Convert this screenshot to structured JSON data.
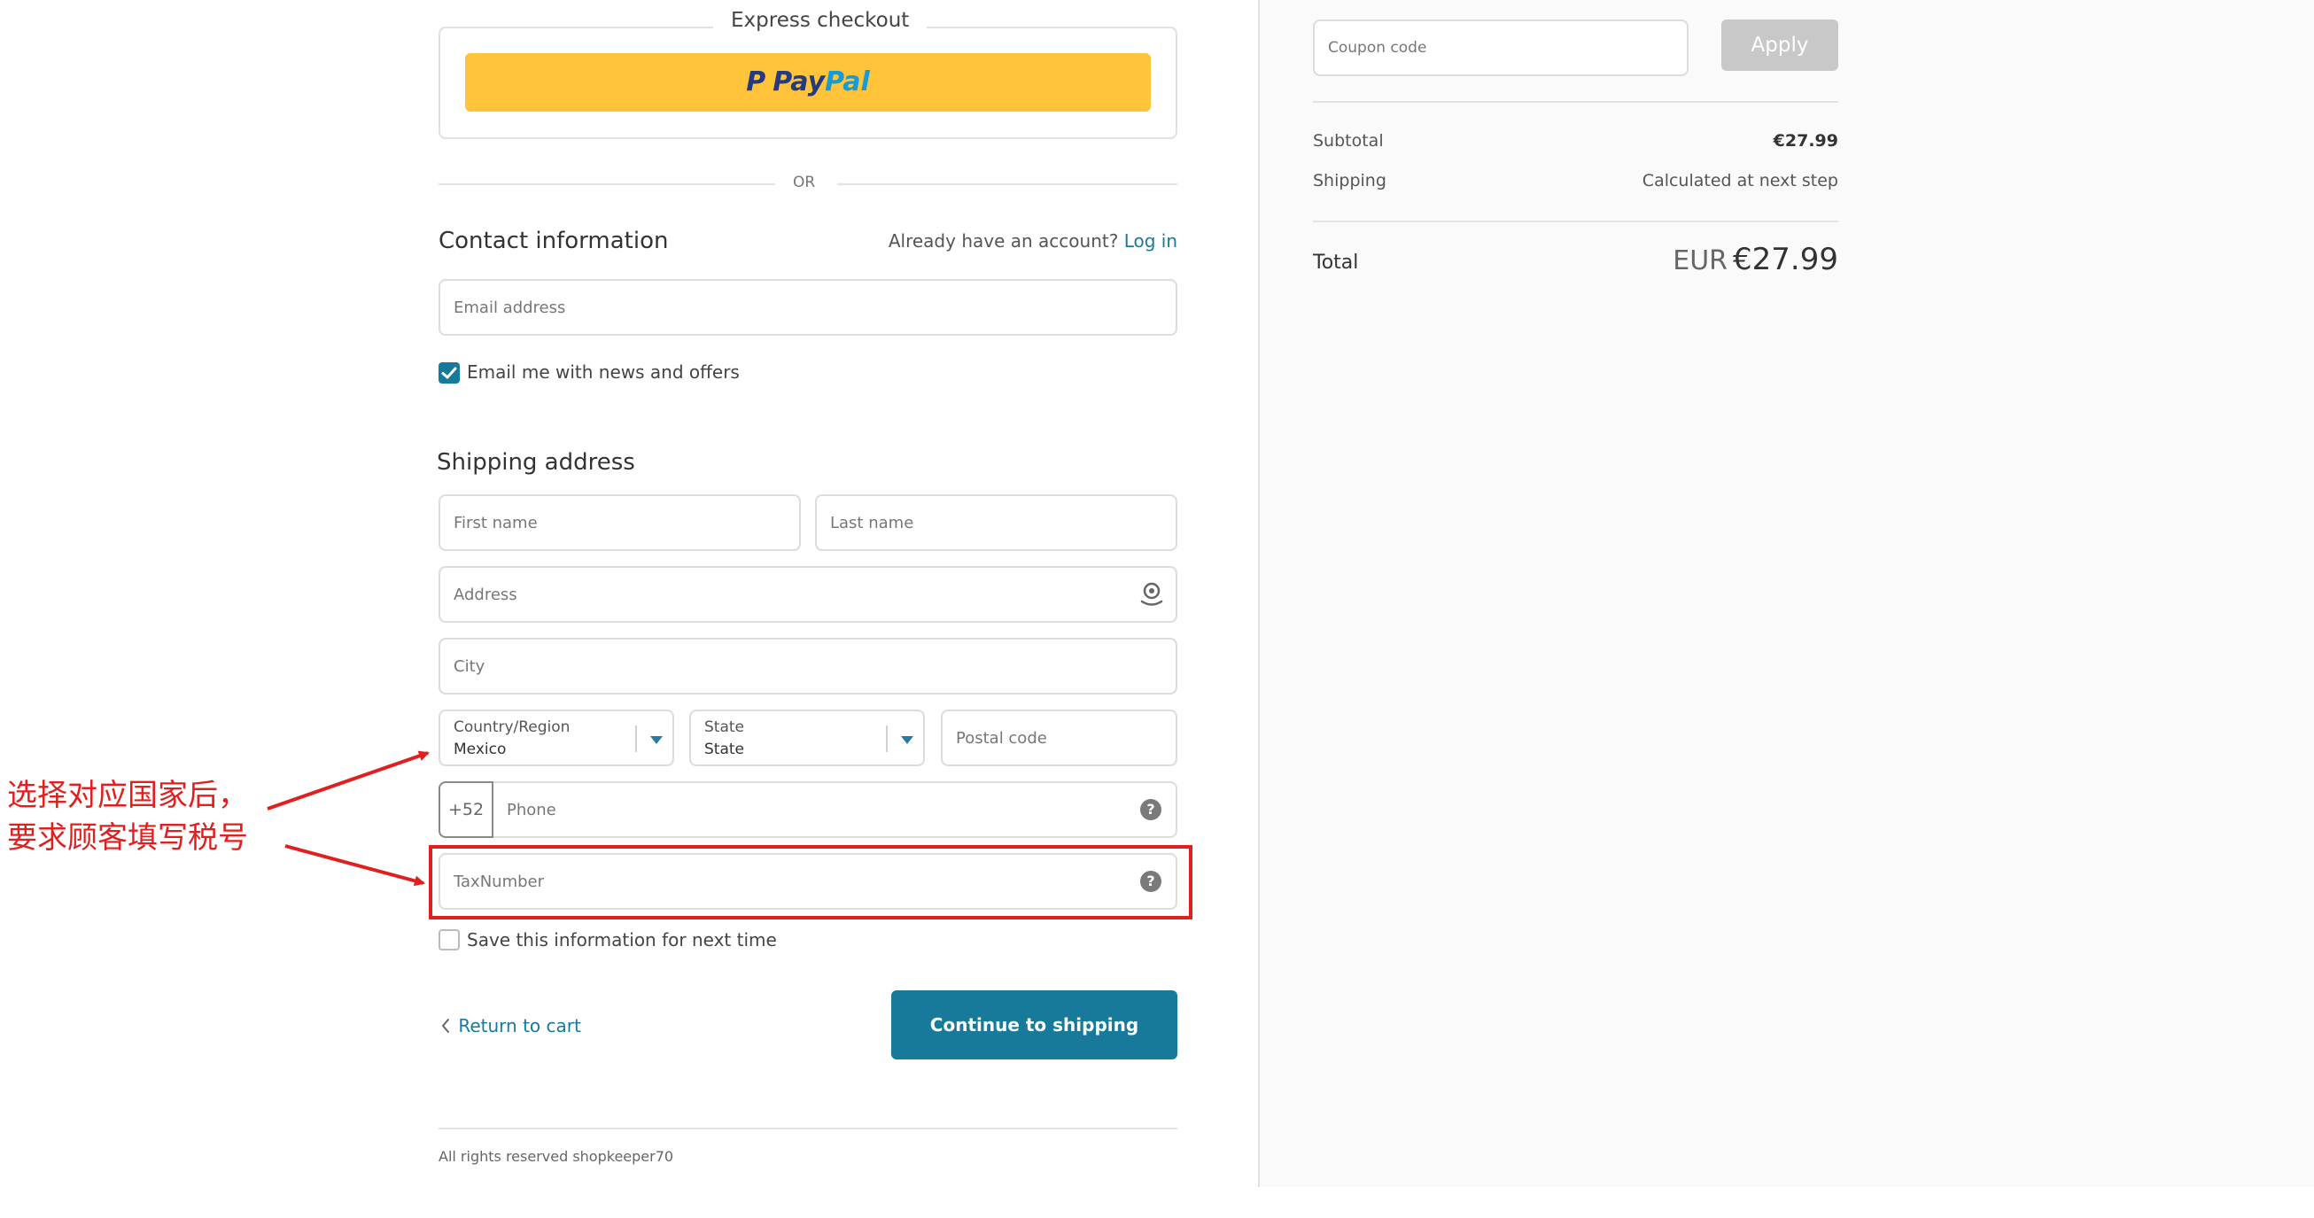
{
  "express": {
    "label": "Express checkout",
    "paypal": {
      "p": "P",
      "pay": "Pay",
      "pal": "Pal"
    }
  },
  "or_label": "OR",
  "contact": {
    "title": "Contact information",
    "account_prompt": "Already have an account?",
    "login_label": "Log in",
    "email_placeholder": "Email address",
    "newsletter_label": "Email me with news and offers",
    "newsletter_checked": true
  },
  "shipping": {
    "title": "Shipping address",
    "first_name_placeholder": "First name",
    "last_name_placeholder": "Last name",
    "address_placeholder": "Address",
    "city_placeholder": "City",
    "country_label": "Country/Region",
    "country_value": "Mexico",
    "state_label": "State",
    "state_value": "State",
    "postal_placeholder": "Postal code",
    "phone_prefix": "+52",
    "phone_placeholder": "Phone",
    "tax_placeholder": "TaxNumber",
    "save_label": "Save this information for next time",
    "save_checked": false
  },
  "nav": {
    "return_label": "Return to cart",
    "continue_label": "Continue to shipping"
  },
  "footer": {
    "copyright": "All rights reserved shopkeeper70"
  },
  "annotation": {
    "line1": "选择对应国家后，",
    "line2": "要求顾客填写税号",
    "color": "#e0201e"
  },
  "summary": {
    "coupon_placeholder": "Coupon code",
    "apply_label": "Apply",
    "subtotal_label": "Subtotal",
    "subtotal_value": "€27.99",
    "shipping_label": "Shipping",
    "shipping_value": "Calculated at next step",
    "total_label": "Total",
    "total_currency": "EUR",
    "total_value": "€27.99"
  },
  "colors": {
    "accent": "#187a9a",
    "paypal_yellow": "#ffc439",
    "panel_bg": "#fafafa"
  }
}
